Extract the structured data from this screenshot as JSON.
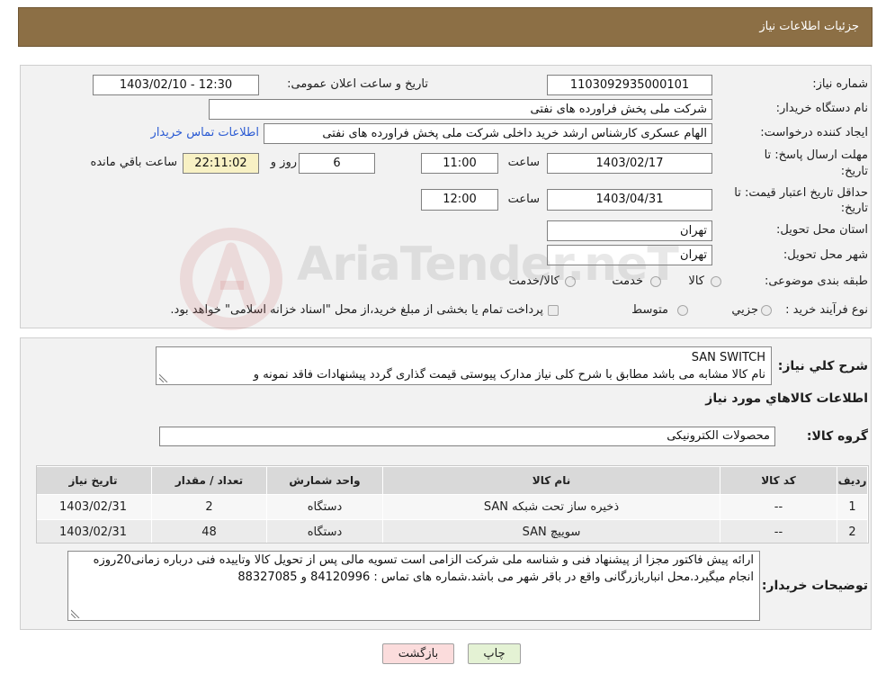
{
  "header": {
    "title": "جزئیات اطلاعات نیاز"
  },
  "watermark": {
    "text": "AriaTender.neT"
  },
  "theme": {
    "header_bg": "#8c6f45",
    "remaining_bg": "#f8f1c4",
    "link_color": "#2b5bd3",
    "print_btn_bg": "#e4f2d4",
    "back_btn_bg": "#fbdcdc"
  },
  "details": {
    "need_number_label": "شماره نیاز:",
    "need_number": "1103092935000101",
    "announce_label": "تاریخ و ساعت اعلان عمومی:",
    "announce_value": "1403/02/10 - 12:30",
    "buyer_org_label": "نام دستگاه خریدار:",
    "buyer_org": "شرکت ملی پخش فراورده های نفتی",
    "creator_label": "ایجاد کننده درخواست:",
    "creator": "الهام عسکری کارشناس ارشد خرید داخلی شرکت ملی پخش فراورده های نفتی",
    "contact_link": "اطلاعات تماس خریدار",
    "deadline_label_line1": "مهلت ارسال پاسخ: تا",
    "deadline_label_line2": "تاریخ:",
    "deadline_date": "1403/02/17",
    "deadline_time_label": "ساعت",
    "deadline_time": "11:00",
    "days_remaining": "6",
    "days_label": "روز و",
    "time_remaining": "22:11:02",
    "remaining_label": "ساعت باقي مانده",
    "validity_label_line1": "حداقل تاریخ اعتبار قیمت: تا",
    "validity_label_line2": "تاریخ:",
    "validity_date": "1403/04/31",
    "validity_time_label": "ساعت",
    "validity_time": "12:00",
    "province_label": "استان محل تحویل:",
    "province": "تهران",
    "city_label": "شهر محل تحویل:",
    "city": "تهران",
    "category_label": "طبقه بندی موضوعی:",
    "category_options": [
      "کالا",
      "خدمت",
      "کالا/خدمت"
    ],
    "process_label": "نوع فرآیند خرید :",
    "process_options": [
      "جزيي",
      "متوسط"
    ],
    "treasury_note": "پرداخت تمام یا بخشی از مبلغ خرید،از محل \"اسناد خزانه اسلامی\" خواهد بود."
  },
  "need": {
    "description_label": "شرح کلي نياز:",
    "description_lines": [
      "SAN SWITCH",
      "نام کالا مشابه می باشد مطابق با شرح کلی نیاز مدارک پیوستی قیمت گذاری گردد پیشنهادات فاقد نمونه و"
    ],
    "goods_heading": "اطلاعات کالاهاي مورد نياز",
    "group_label": "گروه کالا:",
    "group_value": "محصولات الکترونیکی",
    "table": {
      "headers": [
        "ردیف",
        "کد کالا",
        "نام کالا",
        "واحد شمارش",
        "تعداد / مقدار",
        "تاریخ نیاز"
      ],
      "rows": [
        [
          "1",
          "--",
          "ذخیره ساز تحت شبکه SAN",
          "دستگاه",
          "2",
          "1403/02/31"
        ],
        [
          "2",
          "--",
          "سوییچ SAN",
          "دستگاه",
          "48",
          "1403/02/31"
        ]
      ]
    },
    "buyer_notes_label": "توضیحات خریدار:",
    "buyer_notes": "ارائه پیش فاکتور مجزا از پیشنهاد فنی و شناسه ملی شرکت الزامی است تسویه مالی پس از تحویل کالا وتاییده فنی درباره زمانی20روزه انجام میگیرد.محل انباربازرگانی واقع در باقر شهر می باشد.شماره های تماس : 84120996 و 88327085"
  },
  "buttons": {
    "print": "چاپ",
    "back": "بازگشت"
  }
}
